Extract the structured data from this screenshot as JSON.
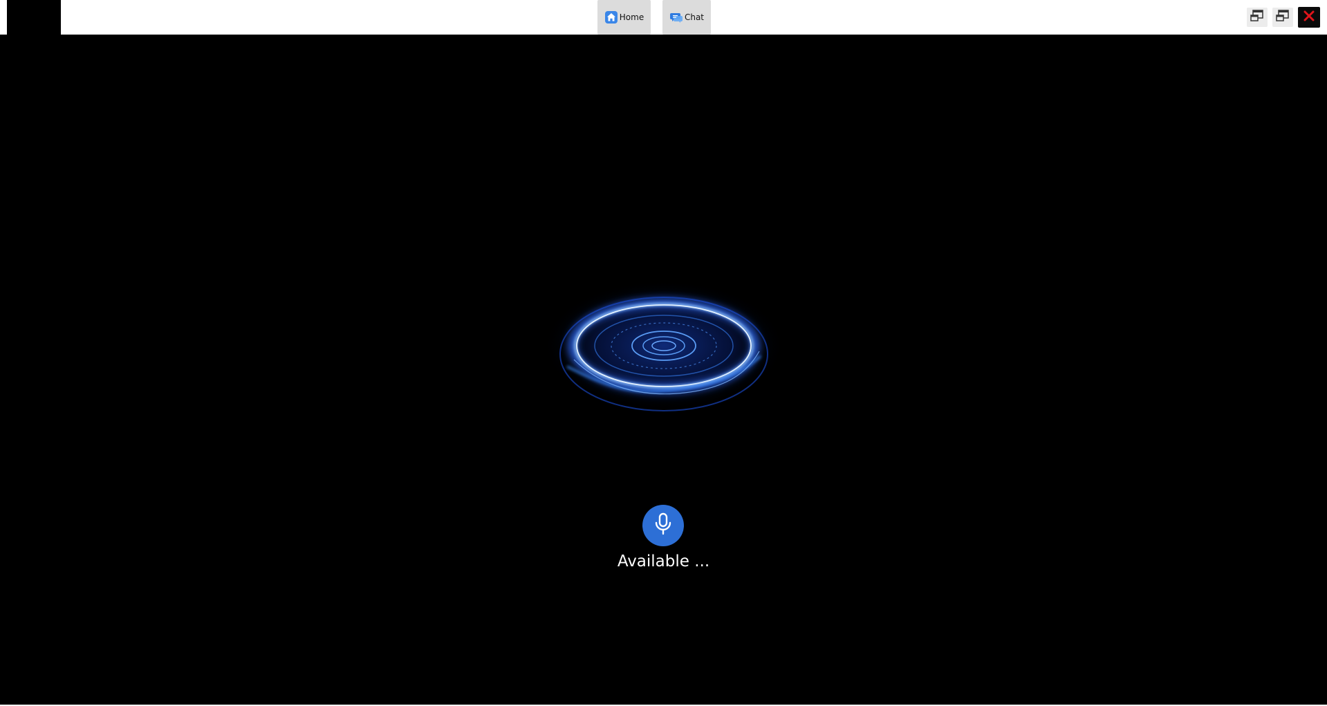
{
  "tabs": {
    "home": {
      "label": "Home",
      "icon": "home-icon"
    },
    "chat": {
      "label": "Chat",
      "icon": "chat-icon"
    }
  },
  "window_controls": {
    "restore_1_icon": "window-restore-icon",
    "restore_2_icon": "window-restore-icon",
    "close_icon": "close-icon"
  },
  "assistant": {
    "visual": "glowing-blue-orb",
    "mic_icon": "microphone-icon",
    "status": "Available ..."
  },
  "colors": {
    "accent": "#2d6fd6",
    "orb_glow": "#3a8cff",
    "close": "#e0151b",
    "background": "#000000"
  }
}
